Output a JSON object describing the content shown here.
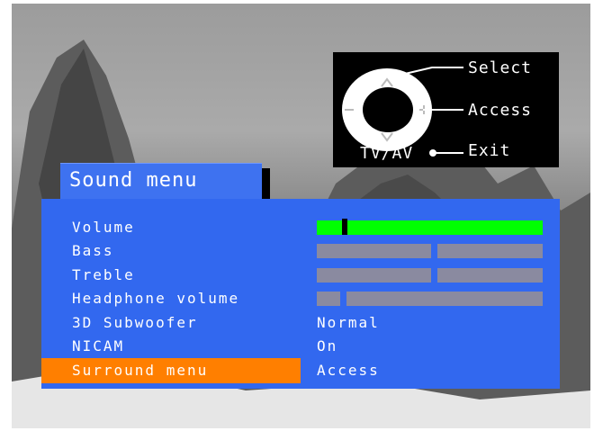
{
  "remote": {
    "select_label": "Select",
    "access_label": "Access",
    "exit_label": "Exit",
    "tvav_label": "TV/AV"
  },
  "menu": {
    "title": "Sound menu",
    "items": [
      {
        "label": "Volume",
        "type": "slider",
        "level": 0.11
      },
      {
        "label": "Bass",
        "type": "slider",
        "level": 0.5
      },
      {
        "label": "Treble",
        "type": "slider",
        "level": 0.5
      },
      {
        "label": "Headphone volume",
        "type": "slider",
        "level": 0.11
      },
      {
        "label": "3D Subwoofer",
        "type": "value",
        "value": "Normal"
      },
      {
        "label": "NICAM",
        "type": "value",
        "value": "On"
      },
      {
        "label": "Surround menu",
        "type": "value",
        "value": "Access",
        "highlighted": true
      }
    ]
  },
  "colors": {
    "panel": "#3268ef",
    "highlight": "#ff7f00",
    "volume_fill": "#00ff00",
    "slider_track": "#8a8aa0"
  }
}
